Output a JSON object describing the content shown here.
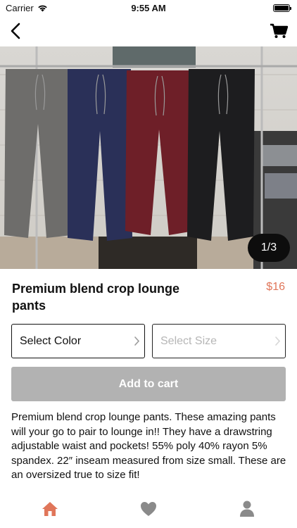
{
  "status_bar": {
    "carrier": "Carrier",
    "time": "9:55 AM"
  },
  "nav": {
    "back_icon": "chevron-left-icon",
    "cart_icon": "cart-icon"
  },
  "gallery": {
    "pager": "1/3",
    "colors": [
      "#6e6d6b",
      "#2a3058",
      "#6e1f28",
      "#1d1d1f"
    ]
  },
  "product": {
    "title": "Premium blend crop lounge pants",
    "price": "$16"
  },
  "options": {
    "color_label": "Select Color",
    "size_label": "Select Size"
  },
  "actions": {
    "add_to_cart": "Add to cart"
  },
  "description": "Premium blend crop lounge pants. These amazing pants will your go to pair to lounge in!!  They have a drawstring adjustable waist and pockets!  55% poly 40% rayon 5% spandex.  22″ inseam measured from size small.  These are an oversized true to size fit!",
  "tab_bar": {
    "items": [
      "home-icon",
      "heart-icon",
      "profile-icon"
    ],
    "active_color": "#e0765a",
    "inactive_color": "#8a8a8a"
  }
}
